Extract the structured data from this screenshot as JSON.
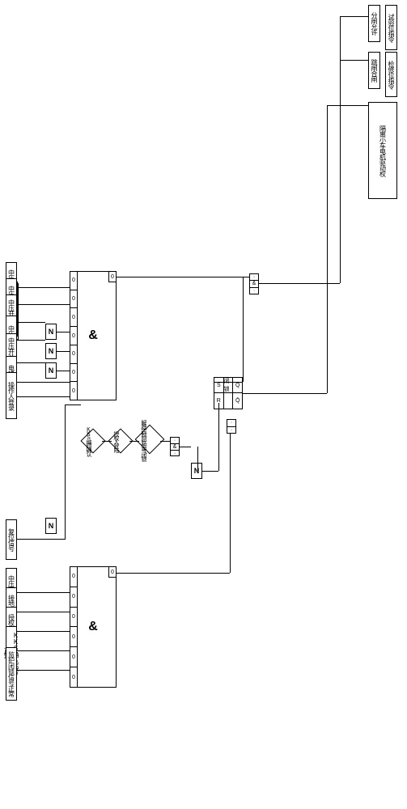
{
  "inputs_top": [
    "中压开关远方位",
    "中压开关在分位",
    "中压开关电流为0A",
    "中压开关故障",
    "中压开关事故跳闸信号",
    "电操故障",
    "操作人登录"
  ],
  "inputs_bottom": [
    "复位信号",
    "中压开关在分位",
    "接地刀闸在分位",
    "授权信号正常",
    "KKS确认信号正常",
    "监护闭锁信号正常"
  ],
  "diamonds": [
    "KKS编码确认",
    "授权人登陆",
    "解除控制回路电气闭锁"
  ],
  "gates": {
    "and": "&",
    "not": "N",
    "zero": "0"
  },
  "sr": {
    "s": "S",
    "q": "Q",
    "r": "R",
    "qn": "Q̄",
    "mid": "闭锁"
  },
  "outputs": {
    "o1a": "分闸允许",
    "o1b": "试验位指令",
    "o2a": "跳闸合闸",
    "o2b": "检修位指令",
    "big": "隔离小车电机驱动权"
  }
}
